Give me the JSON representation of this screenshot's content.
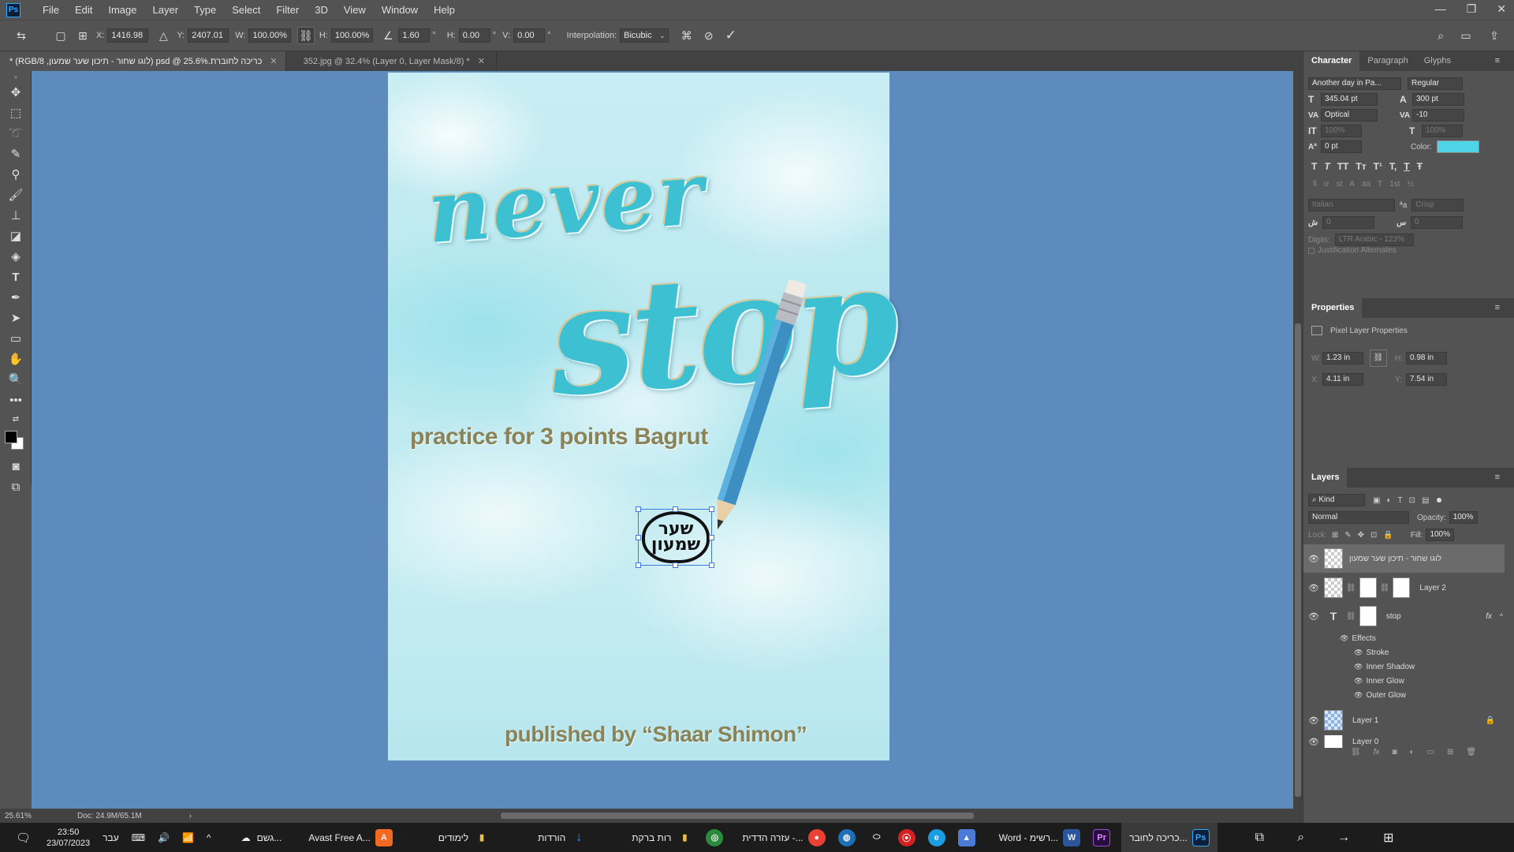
{
  "app": {
    "logo": "Ps"
  },
  "menu": [
    "File",
    "Edit",
    "Image",
    "Layer",
    "Type",
    "Select",
    "Filter",
    "3D",
    "View",
    "Window",
    "Help"
  ],
  "window_controls": {
    "minimize": "—",
    "restore": "❐",
    "close": "✕"
  },
  "options": {
    "x_label": "X:",
    "x": "1416.98 px",
    "y_label": "Y:",
    "y": "2407.01 px",
    "w_label": "W:",
    "w": "100.00%",
    "h_label": "H:",
    "h": "100.00%",
    "angle": "1.60",
    "angle_unit": "°",
    "hskew_label": "H:",
    "hskew": "0.00",
    "hskew_unit": "°",
    "vskew_label": "V:",
    "vskew": "0.00",
    "vskew_unit": "°",
    "interp_label": "Interpolation:",
    "interp": "Bicubic"
  },
  "doc_tabs": [
    {
      "label": "כריכה לחוברת.psd @ 25.6% (לוגו שחור - תיכון שער שמעון, RGB/8) *",
      "close": "✕"
    },
    {
      "label": "352.jpg @ 32.4% (Layer 0, Layer Mask/8) *",
      "close": "✕"
    }
  ],
  "artwork": {
    "never": "never",
    "stop": "stop",
    "subtitle": "practice for 3 points Bagrut",
    "publisher": "published by “Shaar Shimon”",
    "logo_text_line1": "שער",
    "logo_text_line2": "שמעון"
  },
  "status": {
    "zoom": "25.61%",
    "doc": "Doc: 24.9M/65.1M",
    "arrow": "›"
  },
  "character": {
    "tabs": [
      "Character",
      "Paragraph",
      "Glyphs"
    ],
    "font": "Another day in Pa...",
    "style": "Regular",
    "size": "345.04 pt",
    "leading": "300 pt",
    "kerning": "Optical",
    "tracking": "-10",
    "vscale": "100%",
    "hscale": "100%",
    "baseline": "0 pt",
    "color_label": "Color:",
    "color": "#4fd3e6",
    "style_buttons": [
      "T",
      "T",
      "TT",
      "Tт",
      "T¹",
      "T,",
      "T",
      "Ŧ"
    ],
    "ot_buttons": [
      "fi",
      "ơ",
      "st",
      "A",
      "aa",
      "T",
      "1st",
      "½"
    ],
    "language": "Italian",
    "aa_icon": "ªa",
    "antialias": "Crisp",
    "kashida_left": "0",
    "kashida_right": "0",
    "digits_label": "Digits:",
    "digits": "LTR Arabic - 123%",
    "justification": "Justification Alternates"
  },
  "properties": {
    "title": "Properties",
    "type": "Pixel Layer Properties",
    "w_label": "W:",
    "w": "1.23 in",
    "h_label": "H:",
    "h": "0.98 in",
    "x_label": "X:",
    "x": "4.11 in",
    "y_label": "Y:",
    "y": "7.54 in"
  },
  "layers": {
    "title": "Layers",
    "filter": "Kind",
    "blend": "Normal",
    "opacity_label": "Opacity:",
    "opacity": "100%",
    "lock_label": "Lock:",
    "fill_label": "Fill:",
    "fill": "100%",
    "items": [
      {
        "name": "לוגו שחור - תיכון שער שמעון"
      },
      {
        "name": "Layer 2"
      },
      {
        "name": "stop",
        "fx": "fx"
      },
      {
        "name": "Layer 1"
      },
      {
        "name": "Layer 0"
      }
    ],
    "effects_label": "Effects",
    "effects": [
      "Stroke",
      "Inner Shadow",
      "Inner Glow",
      "Outer Glow"
    ]
  },
  "taskbar": {
    "time": "23:50",
    "date": "23/07/2023",
    "lang": "עבר",
    "weather": "גשם...",
    "items": [
      {
        "label": "Avast Free A...",
        "icon": "A",
        "color": "#f26a22"
      },
      {
        "label": "לימודים",
        "icon": "▮",
        "color": "#e8c14a"
      },
      {
        "label": "הורדות",
        "icon": "↓",
        "color": "#3a8ee6"
      },
      {
        "label": "רות ברקת",
        "icon": "▮",
        "color": "#e8c14a"
      },
      {
        "label": "עזרה הדדית -...",
        "icon": "●",
        "color": "#e94235"
      },
      {
        "label": "Word - רשימ...",
        "icon": "W",
        "color": "#2b579a"
      },
      {
        "label": "כריכה לחובר...",
        "icon": "Ps",
        "color": "#0a1f3a"
      }
    ]
  }
}
